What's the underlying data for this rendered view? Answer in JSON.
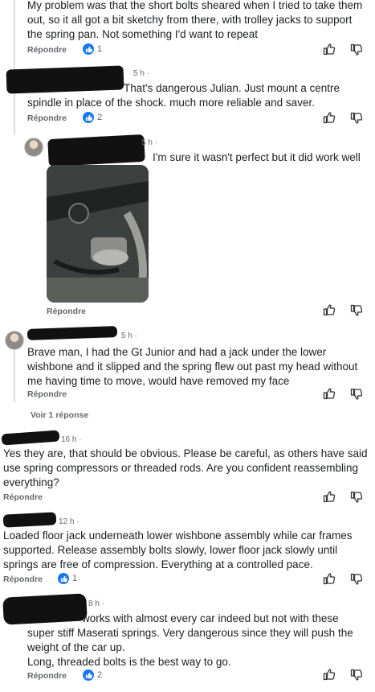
{
  "comments": [
    {
      "text": "My problem was that the short bolts sheared when I tried to take them out, so it all got a bit sketchy from there, with trolley jacks to support the spring pan. Not something I'd want to repeat",
      "reply_label": "Répondre",
      "likes": "1"
    },
    {
      "time": "5 h ·",
      "text": "That's dangerous Julian. Just mount a centre spindle in place of the shock. much more reliable and saver.",
      "reply_label": "Répondre",
      "likes": "2"
    },
    {
      "time": "5 h ·",
      "text": "I'm sure it wasn't perfect but it did work well",
      "reply_label": "Répondre"
    },
    {
      "time": "5 h ·",
      "text": "Brave man, I had the Gt Junior and had a jack under the lower wishbone and it slipped and the spring flew out past my head without me having time to move, would have removed my face",
      "reply_label": "Répondre",
      "see_replies": "Voir 1 réponse"
    },
    {
      "time": "16 h ·",
      "text": "Yes they are, that should be obvious. Please be careful, as others have said use spring compressors or threaded rods. Are you confident reassembling everything?",
      "reply_label": "Répondre"
    },
    {
      "time": "12 h ·",
      "text": "Loaded floor jack underneath lower wishbone assembly while car frames supported. Release assembly bolts slowly, lower floor jack slowly until springs are free of compression. Everything at a controlled pace.",
      "reply_label": "Répondre",
      "likes": "1"
    },
    {
      "time": "8 h ·",
      "text1": "works with almost every car indeed but not with these super stiff Maserati springs. Very dangerous since they will push the weight of the car up.",
      "text2": "Long, threaded bolts is the best way to go.",
      "reply_label": "Répondre",
      "likes": "2"
    }
  ],
  "icons": {
    "upvote": "thumb-up-outline-icon",
    "downvote": "thumb-down-outline-icon",
    "like_badge": "like-badge-icon"
  },
  "colors": {
    "accent": "#1877f2",
    "muted": "#65676b"
  }
}
